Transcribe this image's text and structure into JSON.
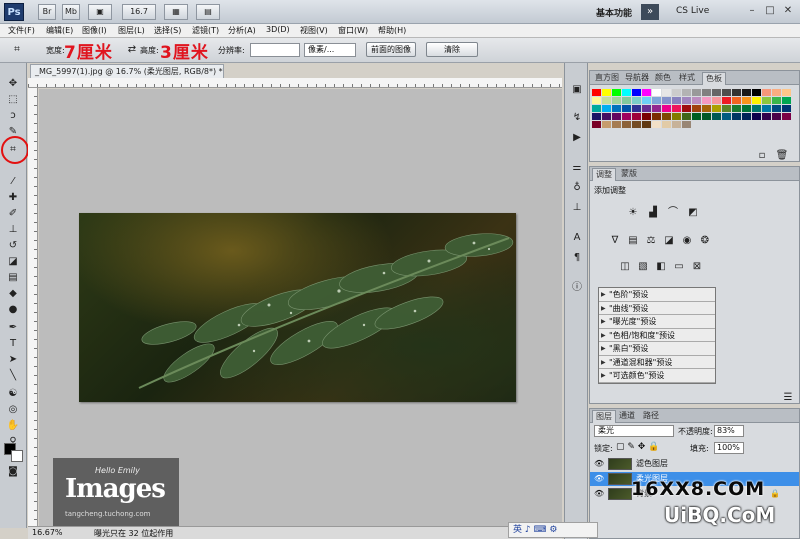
{
  "app": {
    "logo": "Ps",
    "bar_buttons": [
      "Br",
      "Mb",
      "▣",
      "16.7",
      "▦",
      "▤"
    ],
    "workspace_label": "基本功能",
    "cslive_label": "CS Live"
  },
  "menu": [
    "文件(F)",
    "编辑(E)",
    "图像(I)",
    "图层(L)",
    "选择(S)",
    "滤镜(T)",
    "分析(A)",
    "3D(D)",
    "视图(V)",
    "窗口(W)",
    "帮助(H)"
  ],
  "options": {
    "width_label": "宽度:",
    "height_label": "高度:",
    "resolution_label": "分辨率:",
    "unit_select": "像素/...",
    "front_image_button": "前面的图像",
    "clear_button": "清除",
    "annotation_width": "7厘米",
    "annotation_height": "3厘米"
  },
  "document": {
    "tab_title": "_MG_5997(1).jpg @ 16.7% (柔光图层, RGB/8*) *",
    "watermark_big": "Images",
    "watermark_script": "Hello Emily",
    "watermark_url": "tangcheng.tuchong.com"
  },
  "status": {
    "zoom": "16.67%",
    "message": "曝光只在 32 位起作用"
  },
  "swatches_panel": {
    "tabs": [
      "直方图",
      "导航器",
      "颜色",
      "样式",
      "色板"
    ],
    "active_tab": "色板",
    "colors": [
      "#ff0000",
      "#ffff00",
      "#00ff00",
      "#00ffff",
      "#0000ff",
      "#ff00ff",
      "#ffffff",
      "#e6e6e6",
      "#cccccc",
      "#b3b3b3",
      "#999999",
      "#808080",
      "#666666",
      "#4d4d4d",
      "#333333",
      "#1a1a1a",
      "#000000",
      "#f7977a",
      "#f9ad81",
      "#fdc68a",
      "#fff79a",
      "#c4df9b",
      "#a2d39c",
      "#82ca9d",
      "#7bcdc8",
      "#6ecff6",
      "#7ea7d8",
      "#8493ca",
      "#8882be",
      "#a187be",
      "#bc8dbf",
      "#f49ac2",
      "#f6989d",
      "#ed1c24",
      "#f26522",
      "#f7941d",
      "#fff200",
      "#8dc63f",
      "#39b54a",
      "#00a651",
      "#00a99d",
      "#00aeef",
      "#0072bc",
      "#0054a6",
      "#2e3192",
      "#662d91",
      "#92278f",
      "#ec008c",
      "#ed145b",
      "#9e0b0f",
      "#a0410d",
      "#a36209",
      "#aba000",
      "#598527",
      "#1a7b30",
      "#007236",
      "#00746b",
      "#0076a3",
      "#004b80",
      "#003471",
      "#1b1464",
      "#440e62",
      "#630460",
      "#9e005d",
      "#9e0039",
      "#790000",
      "#7b2e00",
      "#7d4900",
      "#827b00",
      "#406618",
      "#005e20",
      "#005826",
      "#005952",
      "#005b7f",
      "#003663",
      "#002157",
      "#0d004c",
      "#32004b",
      "#4b0049",
      "#7b0046",
      "#7a0026",
      "#c69c6d",
      "#a67c52",
      "#8c6239",
      "#754c24",
      "#603913",
      "#f2e0c7",
      "#e2cba6",
      "#c7b299",
      "#998675"
    ]
  },
  "adjustments_panel": {
    "tabs": [
      "调整",
      "蒙版"
    ],
    "active_tab": "调整",
    "title": "添加调整",
    "presets": [
      "\"色阶\"预设",
      "\"曲线\"预设",
      "\"曝光度\"预设",
      "\"色相/饱和度\"预设",
      "\"黑白\"预设",
      "\"通道混和器\"预设",
      "\"可选颜色\"预设"
    ]
  },
  "layers_panel": {
    "tabs": [
      "图层",
      "通道",
      "路径"
    ],
    "active_tab": "图层",
    "blend_mode": "柔光",
    "opacity_label": "不透明度:",
    "opacity_value": "83%",
    "lock_label": "锁定:",
    "fill_label": "填充:",
    "fill_value": "100%",
    "layers": [
      {
        "name": "滤色图层",
        "selected": false
      },
      {
        "name": "柔光图层",
        "selected": true
      },
      {
        "name": "背景",
        "selected": false
      }
    ]
  },
  "overlays": {
    "site_a": "16XX8.COM",
    "site_b": "UiBQ.CoM",
    "ime": "英 ♪ ⌨ ⚙"
  }
}
